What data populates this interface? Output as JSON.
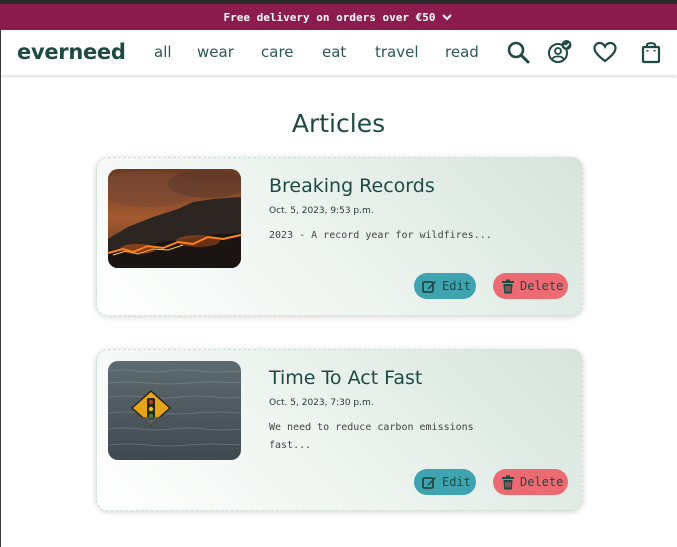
{
  "promo": {
    "text": "Free delivery on orders over €50"
  },
  "brand": {
    "logo": "everneed"
  },
  "nav": {
    "items": [
      {
        "label": "all"
      },
      {
        "label": "wear"
      },
      {
        "label": "care"
      },
      {
        "label": "eat"
      },
      {
        "label": "travel"
      },
      {
        "label": "read"
      }
    ],
    "icons": [
      "search-icon",
      "account-verified-icon",
      "heart-icon",
      "shopping-bag-icon"
    ]
  },
  "page": {
    "title": "Articles"
  },
  "articles": [
    {
      "title": "Breaking Records",
      "date": "Oct. 5, 2023, 9:53 p.m.",
      "excerpt": "2023 - A record year for wildfires...",
      "edit_label": "Edit",
      "delete_label": "Delete",
      "image": "wildfire-hillside"
    },
    {
      "title": "Time To Act Fast",
      "date": "Oct. 5, 2023, 7:30 p.m.",
      "excerpt": "We need to reduce carbon emissions fast...",
      "edit_label": "Edit",
      "delete_label": "Delete",
      "image": "flooded-traffic-sign"
    }
  ],
  "colors": {
    "promo_bg": "#8c1b4e",
    "brand_text": "#1f4a44",
    "edit_button": "#3fa4b0",
    "delete_button": "#ec6a72"
  }
}
